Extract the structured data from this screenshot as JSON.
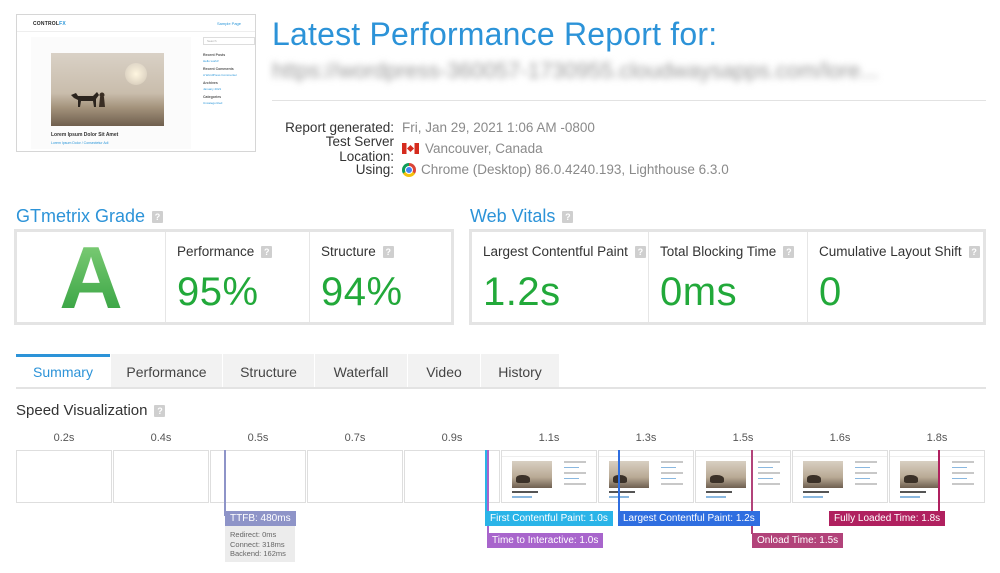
{
  "header": {
    "title": "Latest Performance Report for:",
    "url_blurred": "https://wordpress-360057-1730955.cloudwaysapps.com/lore...",
    "report_generated_label": "Report generated:",
    "report_generated_value": "Fri, Jan 29, 2021 1:06 AM -0800",
    "server_label": "Test Server Location:",
    "server_value": "Vancouver, Canada",
    "using_label": "Using:",
    "using_value": "Chrome (Desktop) 86.0.4240.193, Lighthouse 6.3.0"
  },
  "thumbnail": {
    "brand_a": "CONTROL",
    "brand_b": "FX",
    "top_link": "Sample Page",
    "search_placeholder": "Search",
    "post_title": "Lorem Ipsum Dolor Sit Amet",
    "post_meta": "Lorem Ipsum Dolor / Consectetur Adi",
    "sidebar": [
      "Recent Posts",
      "Hello world!",
      "Recent Comments",
      "A WordPress Commenter",
      "Archives",
      "January 2021",
      "Categories",
      "Uncategorized"
    ]
  },
  "grade": {
    "heading": "GTmetrix Grade",
    "letter": "A",
    "performance_label": "Performance",
    "performance_value": "95%",
    "structure_label": "Structure",
    "structure_value": "94%"
  },
  "vitals": {
    "heading": "Web Vitals",
    "lcp_label": "Largest Contentful Paint",
    "lcp_value": "1.2s",
    "tbt_label": "Total Blocking Time",
    "tbt_value": "0ms",
    "cls_label": "Cumulative Layout Shift",
    "cls_value": "0"
  },
  "help_glyph": "?",
  "tabs": [
    "Summary",
    "Performance",
    "Structure",
    "Waterfall",
    "Video",
    "History"
  ],
  "speed": {
    "heading": "Speed Visualization",
    "times": [
      "0.2s",
      "0.4s",
      "0.5s",
      "0.7s",
      "0.9s",
      "1.1s",
      "1.3s",
      "1.5s",
      "1.6s",
      "1.8s"
    ],
    "frames_loaded_from_index": 5,
    "markers": {
      "ttfb": "TTFB: 480ms",
      "ttfb_details": [
        "Redirect: 0ms",
        "Connect: 318ms",
        "Backend: 162ms"
      ],
      "fcp": "First Contentful Paint: 1.0s",
      "tti": "Time to Interactive: 1.0s",
      "lcp": "Largest Contentful Paint: 1.2s",
      "onload": "Onload Time: 1.5s",
      "fully": "Fully Loaded Time: 1.8s"
    }
  },
  "colors": {
    "accent": "#2c93d8",
    "grade_green": "#22a93a",
    "ttfb": "#8e94c8",
    "fcp": "#2ab4e8",
    "tti": "#a865cc",
    "lcp": "#2f6ee0",
    "onload": "#b2437a",
    "fully": "#b0205f"
  }
}
